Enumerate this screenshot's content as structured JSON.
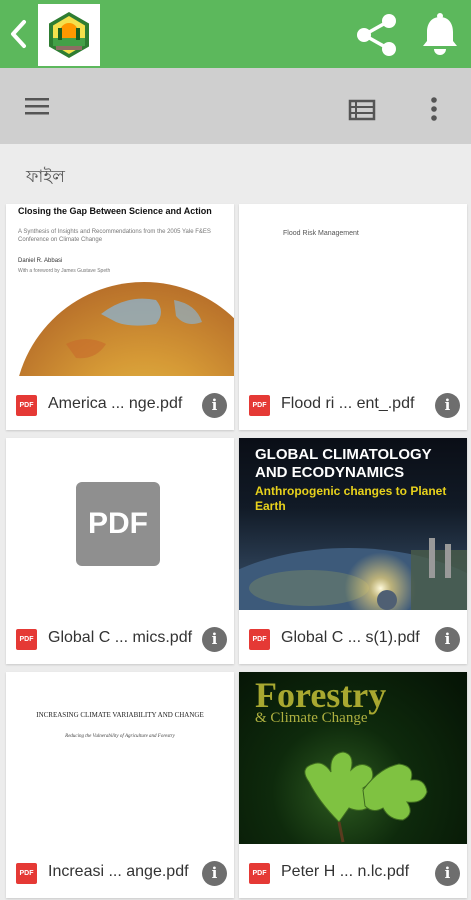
{
  "breadcrumb": {
    "folder": "ফাইল"
  },
  "files": [
    {
      "name": "America ... nge.pdf",
      "badge": "PDF",
      "cover": {
        "title": "Closing the Gap Between Science and Action",
        "subtitle": "A Synthesis of Insights and Recommendations from the 2005 Yale F&ES Conference on Climate Change",
        "author": "Daniel R. Abbasi",
        "foreword": "With a foreword by James Gustave Speth"
      }
    },
    {
      "name": "Flood ri ... ent_.pdf",
      "badge": "PDF",
      "cover": {
        "title": "Flood Risk Management"
      }
    },
    {
      "name": "Global C ... mics.pdf",
      "badge": "PDF",
      "cover": {
        "placeholder": "PDF"
      }
    },
    {
      "name": "Global C ... s(1).pdf",
      "badge": "PDF",
      "cover": {
        "title": "GLOBAL CLIMATOLOGY AND ECODYNAMICS",
        "subtitle": "Anthropogenic changes to Planet Earth"
      }
    },
    {
      "name": "Increasi ... ange.pdf",
      "badge": "PDF",
      "cover": {
        "title": "INCREASING CLIMATE VARIABILITY AND CHANGE",
        "subtitle": "Reducing the Vulnerability of Agriculture and Forestry"
      }
    },
    {
      "name": "Peter H ... n.lc.pdf",
      "badge": "PDF",
      "cover": {
        "title": "Forestry",
        "subtitle": "& Climate Change"
      }
    }
  ],
  "info_glyph": "i",
  "colors": {
    "topbar": "#5cb85c",
    "toolbar": "#cfcfcf",
    "background": "#ececec",
    "pdf_badge": "#e53935",
    "info": "#6e6e6e"
  },
  "icons": {
    "back": "back-arrow-icon",
    "logo": "app-logo-icon",
    "share": "share-icon",
    "bell": "bell-icon",
    "menu": "hamburger-menu-icon",
    "list": "list-view-icon",
    "more": "more-vert-icon"
  }
}
